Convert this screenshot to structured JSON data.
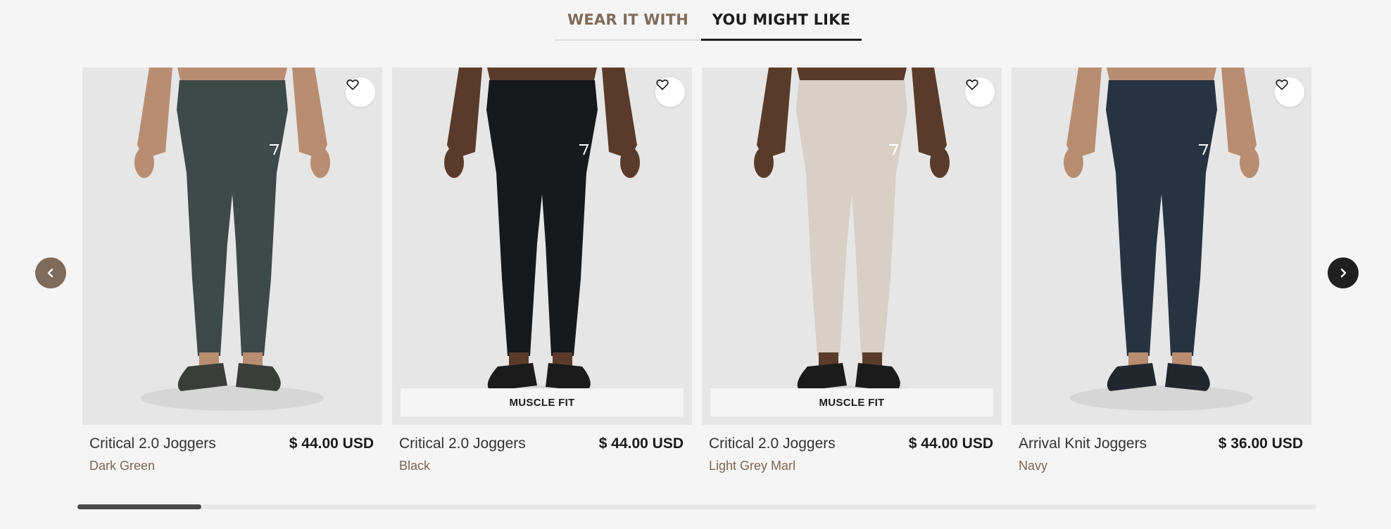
{
  "tabs": [
    {
      "label": "WEAR IT WITH",
      "active": false
    },
    {
      "label": "YOU MIGHT LIKE",
      "active": true
    }
  ],
  "products": [
    {
      "name": "Critical 2.0 Joggers",
      "price": "$ 44.00 USD",
      "color": "Dark Green",
      "badge": "",
      "pant_color": "#3d4a47",
      "shoe_color": "#3a3d3a"
    },
    {
      "name": "Critical 2.0 Joggers",
      "price": "$ 44.00 USD",
      "color": "Black",
      "badge": "MUSCLE FIT",
      "pant_color": "#17191b",
      "shoe_color": "#1b1b1b"
    },
    {
      "name": "Critical 2.0 Joggers",
      "price": "$ 44.00 USD",
      "color": "Light Grey Marl",
      "badge": "MUSCLE FIT",
      "pant_color": "#d8cfc6",
      "shoe_color": "#1b1b1b"
    },
    {
      "name": "Arrival Knit Joggers",
      "price": "$ 36.00 USD",
      "color": "Navy",
      "badge": "",
      "pant_color": "#263442",
      "shoe_color": "#22272d"
    }
  ],
  "icons": {
    "wishlist": "heart-icon",
    "prev": "chevron-left-icon",
    "next": "chevron-right-icon"
  },
  "accent_color": "#806b5a",
  "carousel_scroll": 0.1
}
